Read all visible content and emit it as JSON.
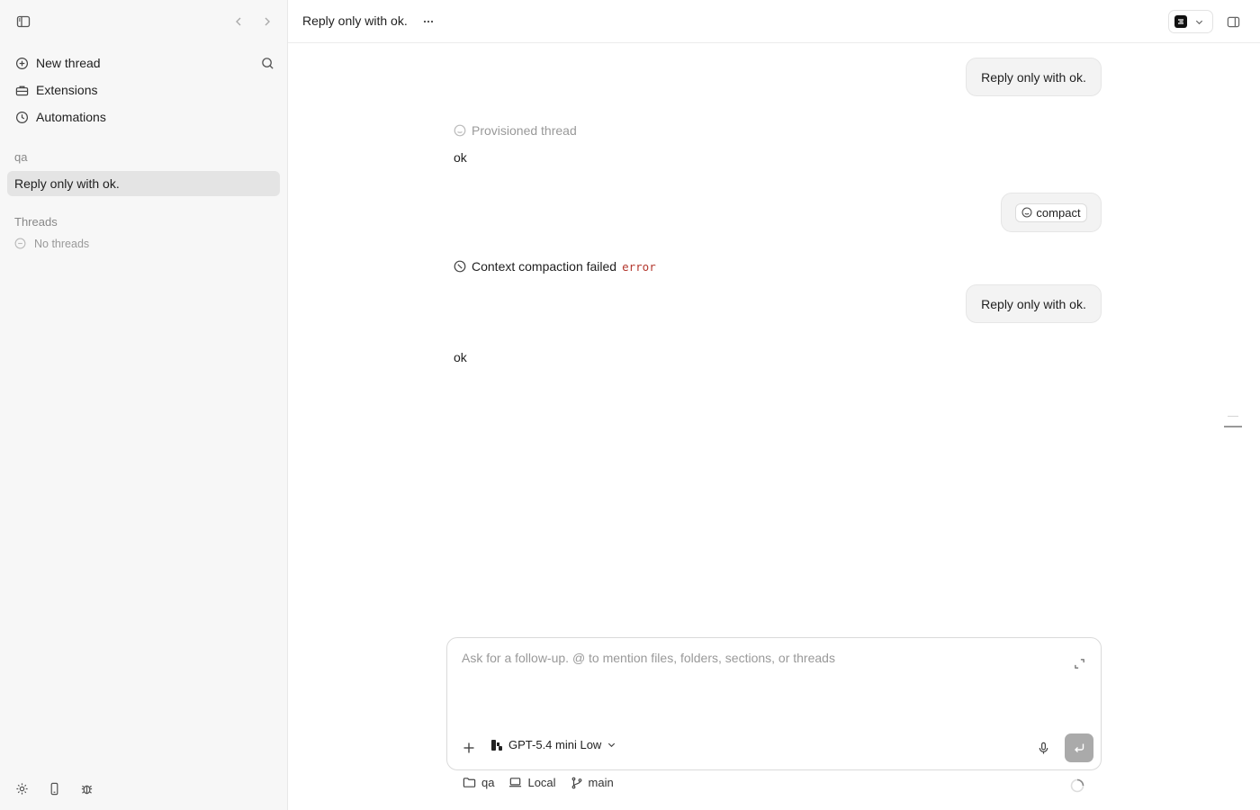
{
  "sidebar": {
    "nav": [
      {
        "label": "New thread",
        "icon": "plus-circle-icon"
      },
      {
        "label": "Extensions",
        "icon": "toolbox-icon"
      },
      {
        "label": "Automations",
        "icon": "clock-icon"
      }
    ],
    "project_label": "qa",
    "active_thread": "Reply only with ok.",
    "threads_label": "Threads",
    "no_threads_label": "No threads"
  },
  "header": {
    "title": "Reply only with ok."
  },
  "messages": {
    "user_1": "Reply only with ok.",
    "system_note": "Provisioned thread",
    "assistant_1": "ok",
    "command_chip": "compact",
    "error_text": "Context compaction failed",
    "error_code": "error",
    "user_2": "Reply only with ok.",
    "assistant_2": "ok"
  },
  "composer": {
    "placeholder": "Ask for a follow-up. @ to mention files, folders, sections, or threads",
    "model_label": "GPT-5.4 mini Low"
  },
  "footer": {
    "folder": "qa",
    "env": "Local",
    "branch": "main"
  },
  "colors": {
    "error_code": "#b3372d",
    "send_button": "#aaaaaa",
    "active_thread_bg": "#e4e4e4"
  }
}
